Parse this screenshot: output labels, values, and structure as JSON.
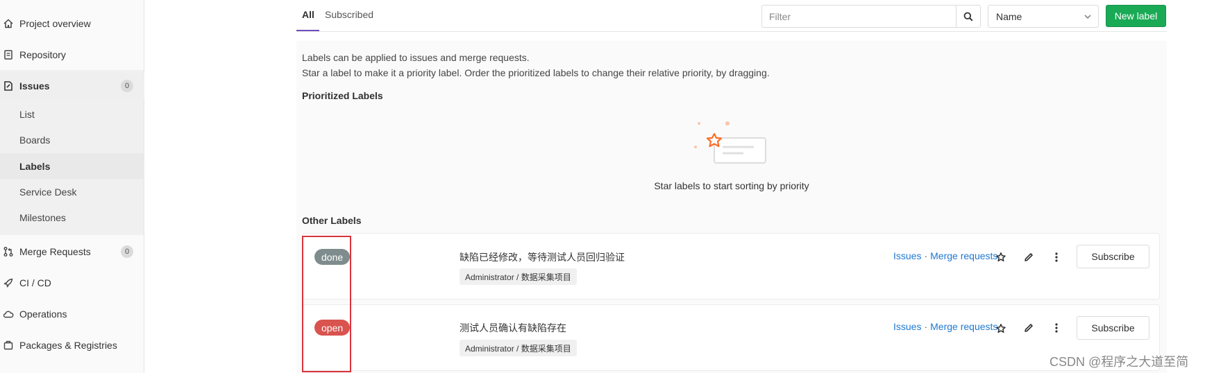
{
  "sidebar": {
    "project_overview": "Project overview",
    "repository": "Repository",
    "issues": {
      "label": "Issues",
      "count": "0"
    },
    "issues_sub": [
      "List",
      "Boards",
      "Labels",
      "Service Desk",
      "Milestones"
    ],
    "merge_requests": {
      "label": "Merge Requests",
      "count": "0"
    },
    "cicd": "CI / CD",
    "operations": "Operations",
    "packages": "Packages & Registries"
  },
  "tabs": {
    "all": "All",
    "subscribed": "Subscribed"
  },
  "toolbar": {
    "filter_placeholder": "Filter",
    "sort_value": "Name",
    "new_label": "New label"
  },
  "intro": {
    "line1": "Labels can be applied to issues and merge requests.",
    "line2": "Star a label to make it a priority label. Order the prioritized labels to change their relative priority, by dragging."
  },
  "prioritized": {
    "title": "Prioritized Labels",
    "empty_text": "Star labels to start sorting by priority"
  },
  "other": {
    "title": "Other Labels",
    "labels": [
      {
        "name": "done",
        "color": "#7f8c8d",
        "description": "缺陷已经修改，等待测试人员回归验证",
        "group": "Administrator / 数据采集项目",
        "issues_link": "Issues",
        "separator": "·",
        "mr_link": "Merge requests",
        "subscribe": "Subscribe"
      },
      {
        "name": "open",
        "color": "#d9534f",
        "description": "测试人员确认有缺陷存在",
        "group": "Administrator / 数据采集项目",
        "issues_link": "Issues",
        "separator": "·",
        "mr_link": "Merge requests",
        "subscribe": "Subscribe"
      }
    ]
  },
  "watermark": "CSDN @程序之大道至简",
  "colors": {
    "accent": "#6b4fbb",
    "primary_button": "#1aaa55",
    "link": "#1f78d1",
    "highlight": "#d9343d"
  }
}
